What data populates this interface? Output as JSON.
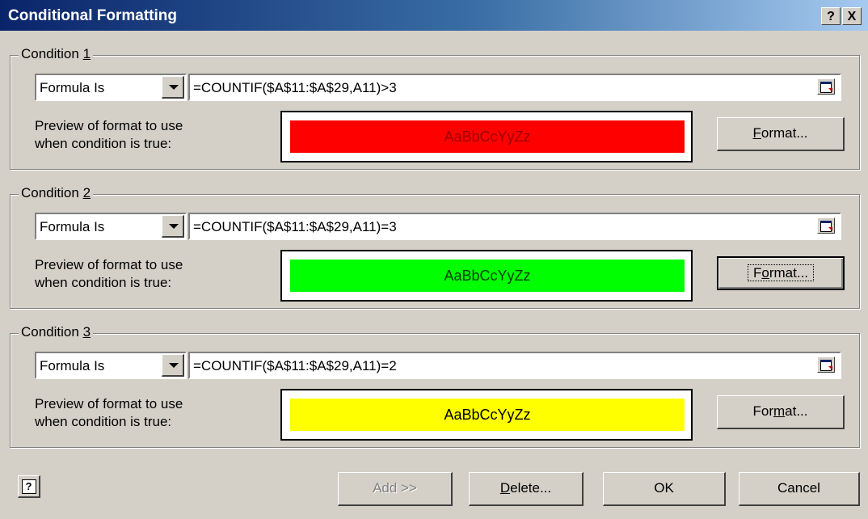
{
  "window": {
    "title": "Conditional Formatting",
    "help_glyph": "?",
    "close_glyph": "X"
  },
  "conditions": [
    {
      "label_prefix": "Condition ",
      "label_key": "1",
      "type": "Formula Is",
      "formula": "=COUNTIF($A$11:$A$29,A11)>3",
      "preview_label_line1": "Preview of format to use",
      "preview_label_line2": "when condition is true:",
      "preview_text": "AaBbCcYyZz",
      "preview_bg": "#ff0000",
      "preview_fg": "#a00000",
      "format_button": {
        "pre": "",
        "key": "F",
        "post": "ormat..."
      }
    },
    {
      "label_prefix": "Condition ",
      "label_key": "2",
      "type": "Formula Is",
      "formula": "=COUNTIF($A$11:$A$29,A11)=3",
      "preview_label_line1": "Preview of format to use",
      "preview_label_line2": "when condition is true:",
      "preview_text": "AaBbCcYyZz",
      "preview_bg": "#00ff00",
      "preview_fg": "#004000",
      "format_button": {
        "pre": "F",
        "key": "o",
        "post": "rmat..."
      }
    },
    {
      "label_prefix": "Condition ",
      "label_key": "3",
      "type": "Formula Is",
      "formula": "=COUNTIF($A$11:$A$29,A11)=2",
      "preview_label_line1": "Preview of format to use",
      "preview_label_line2": "when condition is true:",
      "preview_text": "AaBbCcYyZz",
      "preview_bg": "#ffff00",
      "preview_fg": "#000000",
      "format_button": {
        "pre": "For",
        "key": "m",
        "post": "at..."
      }
    }
  ],
  "footer": {
    "help_icon": "help-icon",
    "add_label": "Add >>",
    "delete_pre": "",
    "delete_key": "D",
    "delete_post": "elete...",
    "ok_label": "OK",
    "cancel_label": "Cancel"
  }
}
